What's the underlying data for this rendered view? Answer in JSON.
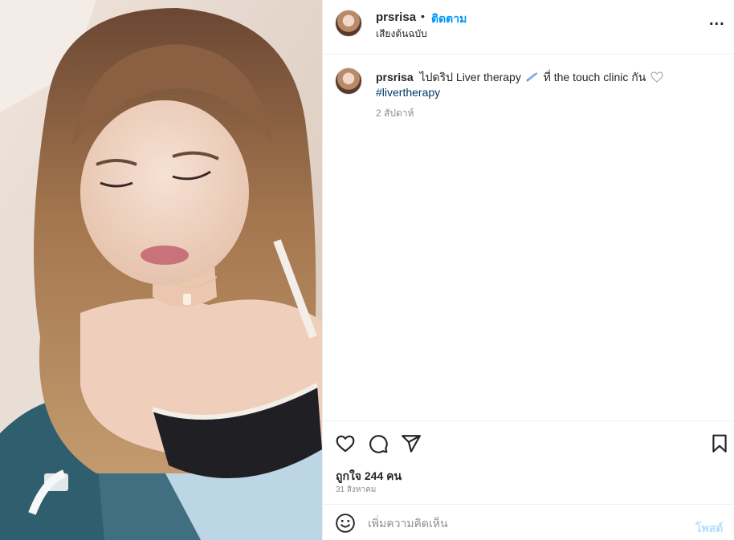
{
  "header": {
    "username": "prsrisa",
    "separator": "•",
    "follow_label": "ติดตาม",
    "audio_label": "เสียงต้นฉบับ",
    "more_label": "..."
  },
  "caption": {
    "username": "prsrisa",
    "text_part1": "ไปดริป Liver therapy",
    "text_part2": "ที่ the touch clinic กัน",
    "hashtag": "#livertherapy",
    "timestamp": "2 สัปดาห์"
  },
  "actions": {
    "like_icon": "heart-icon",
    "comment_icon": "comment-icon",
    "share_icon": "share-icon",
    "save_icon": "bookmark-icon",
    "likes_text": "ถูกใจ 244 คน",
    "date_text": "31 สิงหาคม"
  },
  "comment": {
    "placeholder": "เพิ่มความคิดเห็น",
    "value": "",
    "post_label": "โพสต์"
  },
  "colors": {
    "accent": "#0095f6",
    "hashtag": "#00376b",
    "muted": "#8e8e8e",
    "post_disabled": "#b2dffc"
  }
}
